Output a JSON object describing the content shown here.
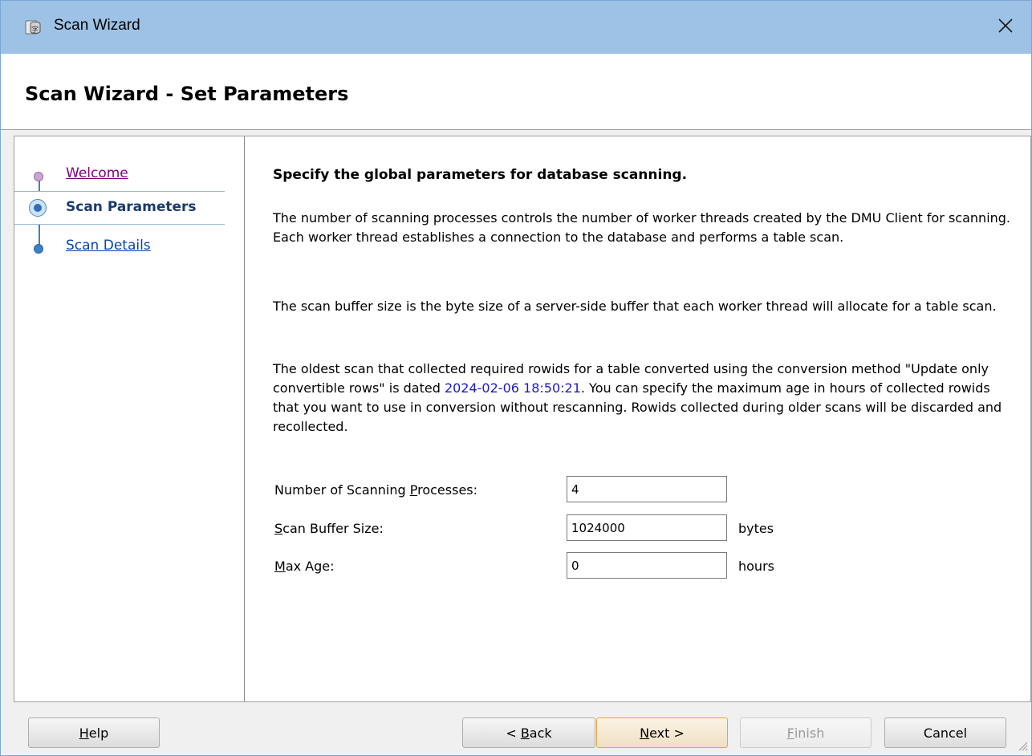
{
  "window": {
    "title": "Scan Wizard",
    "icon": "scan-wizard-app-icon",
    "close_icon": "close-icon"
  },
  "header": {
    "title": "Scan Wizard - Set Parameters"
  },
  "sidebar": {
    "steps": [
      {
        "label": "Welcome",
        "state": "visited"
      },
      {
        "label": "Scan Parameters",
        "state": "current"
      },
      {
        "label": "Scan Details",
        "state": "pending"
      }
    ]
  },
  "content": {
    "heading": "Specify the global parameters for database scanning.",
    "para1": "The number of scanning processes controls the number of worker threads created by the DMU Client for scanning. Each worker thread establishes a connection to the database and performs a table scan.",
    "para2": "The scan buffer size is the byte size of a server-side buffer that each worker thread will allocate for a table scan.",
    "para3_before": "The oldest scan that collected required rowids for a table converted using the conversion method \"Update only convertible rows\" is dated ",
    "para3_date": "2024-02-06 18:50:21",
    "para3_after": ". You can specify the maximum age in hours of collected rowids that you want to use in conversion without rescanning. Rowids collected during older scans will be discarded and recollected."
  },
  "form": {
    "processes": {
      "label_pre": "Number of Scanning ",
      "label_mnemonic": "P",
      "label_post": "rocesses:",
      "value": "4"
    },
    "buffer": {
      "label_pre": "",
      "label_mnemonic": "S",
      "label_post": "can Buffer Size:",
      "value": "1024000",
      "unit": "bytes"
    },
    "age": {
      "label_pre": "",
      "label_mnemonic": "M",
      "label_post": "ax Age:",
      "value": "0",
      "unit": "hours"
    }
  },
  "buttons": {
    "help": {
      "mnemonic": "H",
      "rest": "elp"
    },
    "back": {
      "pre": "< ",
      "mnemonic": "B",
      "rest": "ack"
    },
    "next": {
      "mnemonic": "N",
      "rest": "ext >"
    },
    "finish": {
      "mnemonic": "F",
      "rest": "inish"
    },
    "cancel": {
      "label": "Cancel"
    }
  },
  "colors": {
    "titlebar": "#9dc2e6",
    "visited_link": "#800080",
    "link": "#0645ad",
    "date_highlight": "#1a1ac8",
    "default_button_border": "#e8a33c"
  }
}
